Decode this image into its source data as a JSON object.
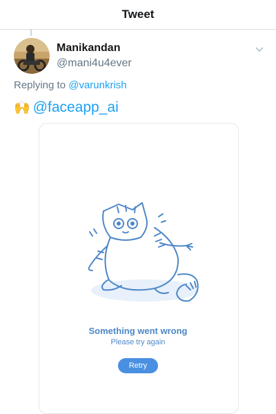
{
  "header": {
    "title": "Tweet"
  },
  "tweet": {
    "author_name": "Manikandan",
    "author_handle": "@mani4u4ever",
    "replying_prefix": "Replying to",
    "replying_to": "@varunkrish",
    "emoji": "🙌",
    "mention": "@faceapp_ai"
  },
  "card": {
    "error_title": "Something went wrong",
    "error_subtitle": "Please try again",
    "retry_label": "Retry",
    "illustration": "confused-cat"
  },
  "colors": {
    "link": "#1da1f2",
    "error_text": "#4d87c7",
    "retry_button": "#4a90e2",
    "secondary_text": "#657786"
  }
}
